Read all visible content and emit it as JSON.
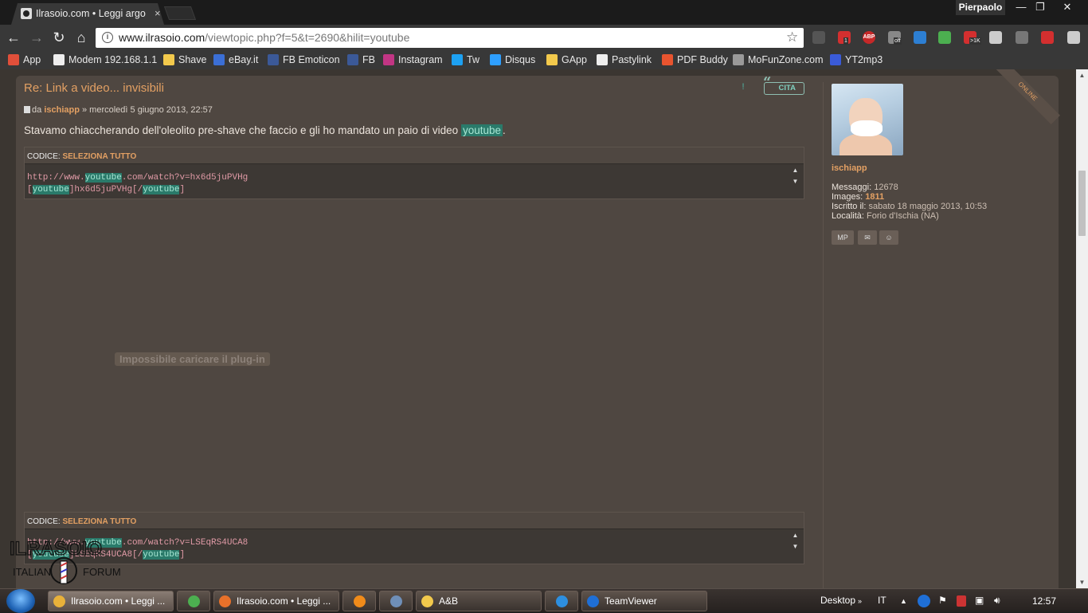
{
  "browser": {
    "tab_title": "Ilrasoio.com • Leggi argo",
    "tab_close": "×",
    "profile_name": "Pierpaolo",
    "window_buttons": {
      "minimize": "—",
      "restore": "❐",
      "close": "✕"
    },
    "url_host": "www.ilrasoio.com",
    "url_rest": "/viewtopic.php?f=5&t=2690&hilit=youtube",
    "nav": {
      "back": "←",
      "forward": "→",
      "reload": "↻",
      "home": "⌂"
    },
    "star": "☆",
    "extensions": [
      {
        "name": "share-icon",
        "color": "#555555"
      },
      {
        "name": "calendar-icon",
        "color": "#d32f2f",
        "badge": "1"
      },
      {
        "name": "adblock-icon",
        "color": "#c62828",
        "label": "ABP"
      },
      {
        "name": "plugin-off-icon",
        "color": "#888888",
        "badge": "off"
      },
      {
        "name": "download-icon",
        "color": "#2d7fd3"
      },
      {
        "name": "evernote-icon",
        "color": "#4caf50"
      },
      {
        "name": "gmail-icon",
        "color": "#d32f2f",
        "badge": ">1K"
      },
      {
        "name": "mail-check-icon",
        "color": "#cccccc"
      },
      {
        "name": "sync-icon",
        "color": "#777777"
      },
      {
        "name": "pinterest-icon",
        "color": "#d32f2f"
      },
      {
        "name": "menu-icon",
        "color": "#cccccc"
      }
    ]
  },
  "bookmarks": [
    {
      "label": "App",
      "icon": "apps-grid-icon",
      "color": "#e04f3a"
    },
    {
      "label": "Modem 192.168.1.1",
      "icon": "page-icon",
      "color": "#eeeeee"
    },
    {
      "label": "Shave",
      "icon": "folder-icon",
      "color": "#f2c94c"
    },
    {
      "label": "eBay.it",
      "icon": "ebay-icon",
      "color": "#3b6fd6"
    },
    {
      "label": "FB Emoticon",
      "icon": "fb-emoticon-icon",
      "color": "#3b5998"
    },
    {
      "label": "FB",
      "icon": "facebook-icon",
      "color": "#3b5998"
    },
    {
      "label": "Instagram",
      "icon": "instagram-icon",
      "color": "#c13584"
    },
    {
      "label": "Tw",
      "icon": "twitter-icon",
      "color": "#1da1f2"
    },
    {
      "label": "Disqus",
      "icon": "disqus-icon",
      "color": "#2e9fff"
    },
    {
      "label": "GApp",
      "icon": "folder-icon",
      "color": "#f2c94c"
    },
    {
      "label": "Pastylink",
      "icon": "pastylink-icon",
      "color": "#eeeeee"
    },
    {
      "label": "PDF Buddy",
      "icon": "pdf-buddy-icon",
      "color": "#e8542f"
    },
    {
      "label": "MoFunZone.com",
      "icon": "mofunzone-icon",
      "color": "#999999"
    },
    {
      "label": "YT2mp3",
      "icon": "yt2mp3-icon",
      "color": "#3a5bd9"
    }
  ],
  "post": {
    "title": "Re: Link a video... invisibili",
    "meta_prefix": "da",
    "author": "ischiapp",
    "meta_date": "» mercoledì 5 giugno 2013, 22:57",
    "quote_label": "CITA",
    "report_label": "!",
    "text_before": "Stavamo chiaccherando dell'oleolito pre-shave che faccio e gli ho mandato un paio di video",
    "text_hl": "youtube",
    "text_after": ".",
    "code_label": "CODICE:",
    "select_all": "SELEZIONA TUTTO",
    "code1": {
      "l1_a": "http://www.",
      "l1_hl": "youtube",
      "l1_b": ".com/watch?v=hx6d5juPVHg",
      "l2_a": "[",
      "l2_hl1": "youtube",
      "l2_b": "]hx6d5juPVHg[/",
      "l2_hl2": "youtube",
      "l2_c": "]"
    },
    "plugin_error": "Impossibile caricare il plug-in",
    "code2": {
      "l1_a": "http://www.",
      "l1_hl": "youtube",
      "l1_b": ".com/watch?v=LSEqRS4UCA8",
      "l2_a": "[",
      "l2_hl1": "youtube",
      "l2_b": "]LSEqRS4UCA8[/",
      "l2_hl2": "youtube",
      "l2_c": "]"
    },
    "scroll_up": "▲",
    "scroll_down": "▼"
  },
  "profile": {
    "username": "ischiapp",
    "online": "ONLINE",
    "messaggi_label": "Messaggi:",
    "messaggi": "12678",
    "images_label": "Images:",
    "images": "1811",
    "iscritto_label": "Iscritto il:",
    "iscritto": "sabato 18 maggio 2013, 10:53",
    "localita_label": "Località:",
    "localita": "Forio d'Ischia (NA)",
    "contacts": [
      "MP",
      "✉",
      "☺"
    ]
  },
  "watermark": {
    "brand": "ILRASOIO",
    "sub1": "ITALIAN",
    "sub2": "FORUM"
  },
  "taskbar": {
    "items": [
      {
        "label": "Ilrasoio.com • Leggi ...",
        "icon": "chrome-icon",
        "color": "#e8b13a",
        "active": true
      },
      {
        "label": "",
        "icon": "globe-icon",
        "color": "#4caf50"
      },
      {
        "label": "Ilrasoio.com • Leggi ...",
        "icon": "firefox-icon",
        "color": "#e8712a"
      },
      {
        "label": "",
        "icon": "vlc-icon",
        "color": "#f08b1a"
      },
      {
        "label": "",
        "icon": "notepad-icon",
        "color": "#6f8fb8"
      },
      {
        "label": "A&B",
        "icon": "folder-icon",
        "color": "#f2c94c"
      },
      {
        "label": "",
        "icon": "ie-icon",
        "color": "#2d8fe0"
      },
      {
        "label": "TeamViewer",
        "icon": "teamviewer-icon",
        "color": "#1f6fd6"
      }
    ],
    "desktop": "Desktop",
    "lang": "IT",
    "clock": "12:57"
  }
}
